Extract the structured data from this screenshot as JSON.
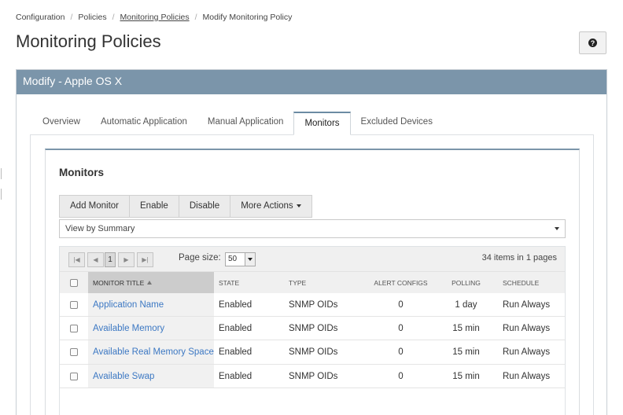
{
  "breadcrumb": [
    "Configuration",
    "Policies",
    "Monitoring Policies",
    "Modify Monitoring Policy"
  ],
  "page_title": "Monitoring Policies",
  "help_icon": "question-circle-icon",
  "panel_title": "Modify - Apple OS X",
  "tabs": [
    "Overview",
    "Automatic Application",
    "Manual Application",
    "Monitors",
    "Excluded Devices"
  ],
  "active_tab": "Monitors",
  "monitors": {
    "title": "Monitors",
    "toolbar": {
      "add": "Add Monitor",
      "enable": "Enable",
      "disable": "Disable",
      "more": "More Actions"
    },
    "view_select": "View by Summary",
    "pager": {
      "first_icon": "first-page-icon",
      "prev_icon": "prev-page-icon",
      "page": "1",
      "next_icon": "next-page-icon",
      "last_icon": "last-page-icon",
      "page_size_label": "Page size:",
      "page_size": "50",
      "info": "34 items in 1 pages"
    },
    "columns": [
      "MONITOR TITLE",
      "STATE",
      "TYPE",
      "ALERT CONFIGS",
      "POLLING",
      "SCHEDULE"
    ],
    "rows": [
      {
        "title": "Application Name",
        "state": "Enabled",
        "type": "SNMP OIDs",
        "alerts": "0",
        "polling": "1 day",
        "schedule": "Run Always"
      },
      {
        "title": "Available Memory",
        "state": "Enabled",
        "type": "SNMP OIDs",
        "alerts": "0",
        "polling": "15 min",
        "schedule": "Run Always"
      },
      {
        "title": "Available Real Memory Space",
        "state": "Enabled",
        "type": "SNMP OIDs",
        "alerts": "0",
        "polling": "15 min",
        "schedule": "Run Always"
      },
      {
        "title": "Available Swap",
        "state": "Enabled",
        "type": "SNMP OIDs",
        "alerts": "0",
        "polling": "15 min",
        "schedule": "Run Always"
      }
    ]
  }
}
